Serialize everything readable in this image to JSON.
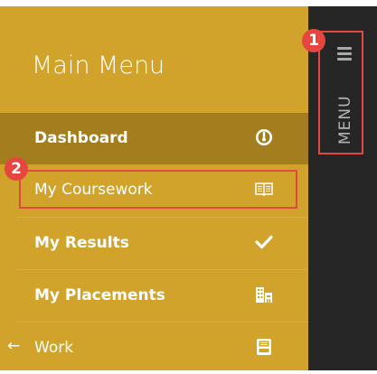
{
  "menu": {
    "title": "Main Menu",
    "items": [
      {
        "label": "Dashboard",
        "icon": "gauge-icon"
      },
      {
        "label": "My Coursework",
        "icon": "open-book-icon"
      },
      {
        "label": "My Results",
        "icon": "checkmark-icon"
      },
      {
        "label": "My Placements",
        "icon": "buildings-icon"
      },
      {
        "label": "Work",
        "icon": "inbox-tray-icon",
        "prefix": "←"
      }
    ]
  },
  "sidebar": {
    "menu_label": "MENU",
    "hamburger_icon": "hamburger-icon"
  },
  "annotations": {
    "badge1": "1",
    "badge2": "2",
    "color": "#e04a43"
  },
  "colors": {
    "panel": "#d1a32b",
    "active": "#a47d1f",
    "sidebar": "#262626"
  }
}
